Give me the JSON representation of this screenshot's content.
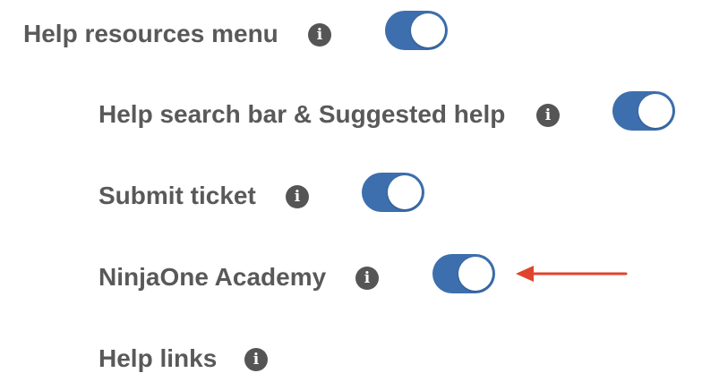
{
  "settings": {
    "rows": [
      {
        "label": "Help resources menu",
        "info_icon": "info-icon",
        "toggle_on": true
      },
      {
        "label": "Help search bar & Suggested help",
        "info_icon": "info-icon",
        "toggle_on": true
      },
      {
        "label": "Submit ticket",
        "info_icon": "info-icon",
        "toggle_on": true
      },
      {
        "label": "NinjaOne Academy",
        "info_icon": "info-icon",
        "toggle_on": true
      },
      {
        "label": "Help links",
        "info_icon": "info-icon"
      }
    ],
    "info_glyph": "i"
  },
  "annotation": {
    "arrow_color": "#e0442c",
    "arrow_icon": "arrow-left-icon"
  },
  "colors": {
    "toggle_on": "#3d6fae",
    "label_text": "#595959",
    "info_icon_bg": "#555555"
  }
}
